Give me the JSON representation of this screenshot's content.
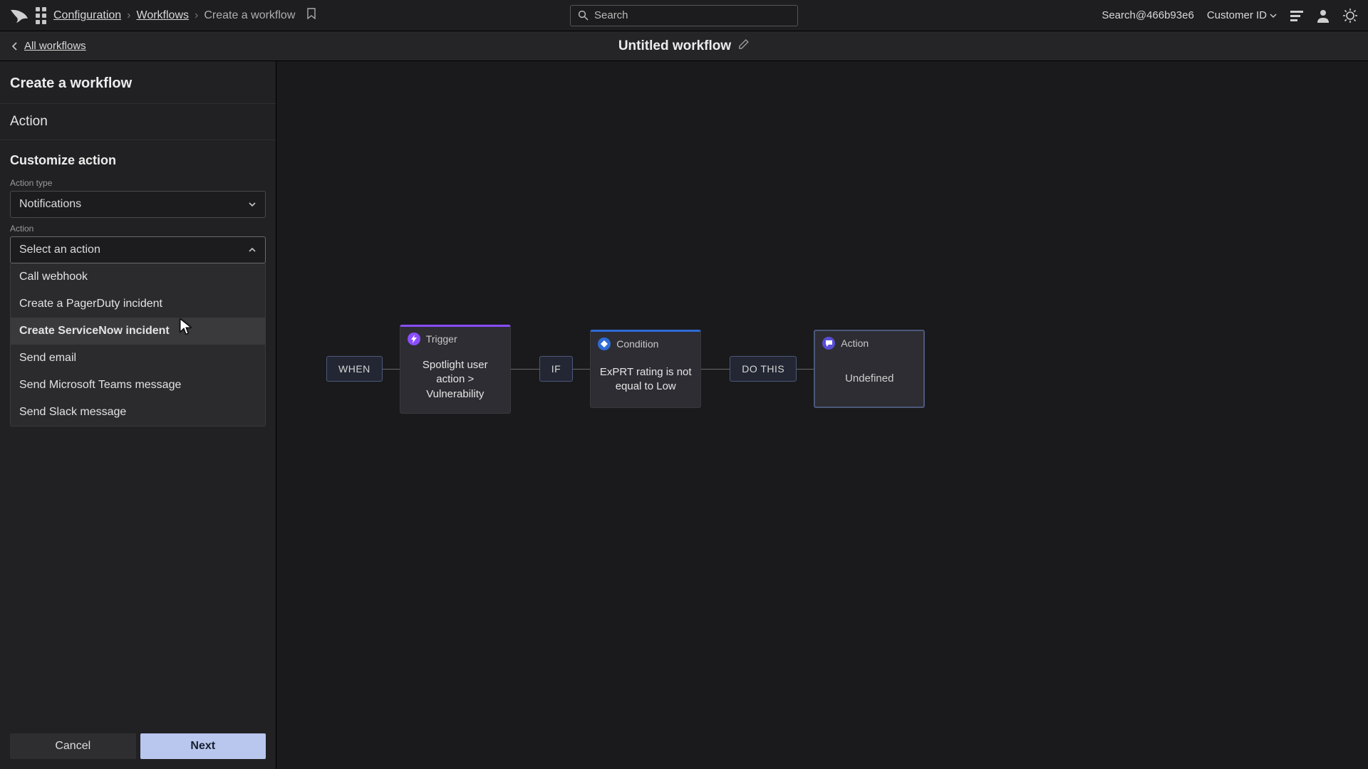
{
  "top": {
    "breadcrumb": {
      "a": "Configuration",
      "b": "Workflows",
      "c": "Create a workflow"
    },
    "search_placeholder": "Search",
    "account": "Search@466b93e6",
    "customer_label": "Customer ID"
  },
  "sub": {
    "back": "All workflows",
    "title": "Untitled workflow"
  },
  "sidebar": {
    "heading": "Create a workflow",
    "step": "Action",
    "section": "Customize action",
    "action_type": {
      "label": "Action type",
      "value": "Notifications"
    },
    "action": {
      "label": "Action",
      "value": "Select an action",
      "options": [
        "Call webhook",
        "Create a PagerDuty incident",
        "Create ServiceNow incident",
        "Send email",
        "Send Microsoft Teams message",
        "Send Slack message"
      ]
    },
    "cancel": "Cancel",
    "next": "Next"
  },
  "flow": {
    "when": "WHEN",
    "if": "IF",
    "do": "DO THIS",
    "trigger": {
      "title": "Trigger",
      "body": "Spotlight user action > Vulnerability"
    },
    "condition": {
      "title": "Condition",
      "body": "ExPRT rating is not equal to Low"
    },
    "action": {
      "title": "Action",
      "body": "Undefined"
    }
  }
}
